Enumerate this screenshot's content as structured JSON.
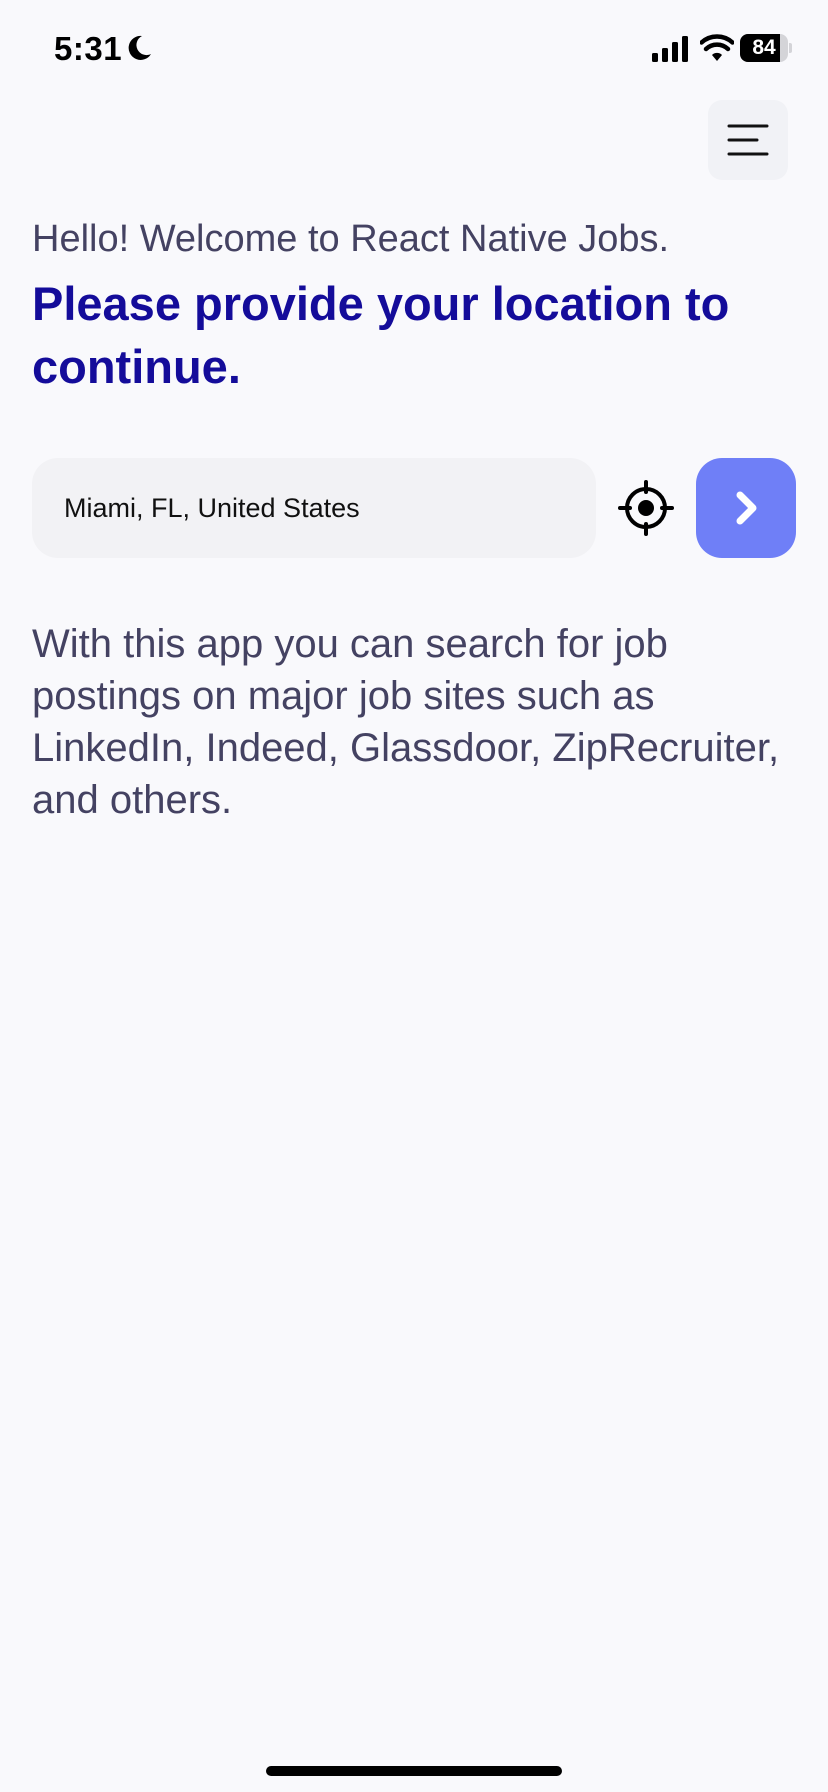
{
  "status_bar": {
    "time": "5:31",
    "battery_level": "84",
    "battery_fraction": 0.84,
    "icons": [
      "moon-icon",
      "signal-icon",
      "wifi-icon",
      "battery-icon"
    ]
  },
  "header": {
    "menu_icon": "hamburger-menu-icon"
  },
  "greeting": {
    "welcome": "Hello! Welcome to React Native Jobs.",
    "prompt": "Please provide your location to continue."
  },
  "search": {
    "location_value": "Miami, FL, United States",
    "locate_icon": "crosshair-icon",
    "go_icon": "chevron-right-icon"
  },
  "description": "With this app you can search for job postings on major job sites such as LinkedIn, Indeed, Glassdoor, ZipRecruiter, and others.",
  "colors": {
    "background": "#f9f9fc",
    "primary": "#140c9a",
    "accent": "#6f7ff7",
    "text": "#444262",
    "input_bg": "#f2f2f5"
  }
}
